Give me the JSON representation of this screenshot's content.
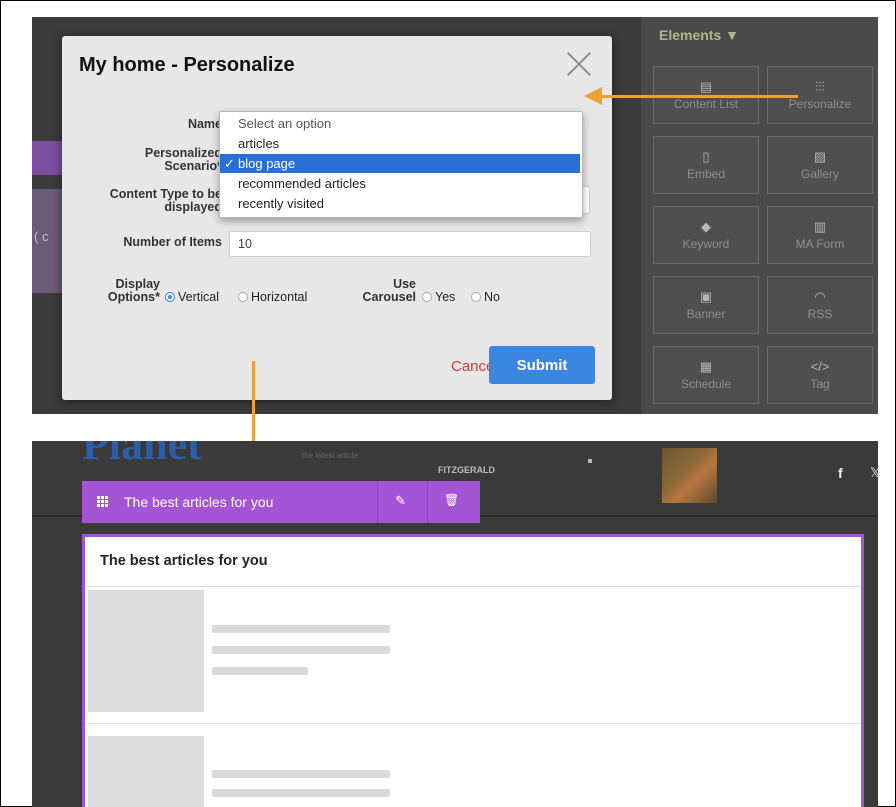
{
  "top_screenshot": {
    "partial_left_text": "( c",
    "elements_panel": {
      "title": "Elements ▼",
      "tiles": [
        {
          "label": "Content List",
          "icon": "content-list-icon",
          "glyph": "▤"
        },
        {
          "label": "Personalize",
          "icon": "personalize-sliders-icon",
          "glyph": "⫶⫶⫶"
        },
        {
          "label": "Embed",
          "icon": "embed-document-icon",
          "glyph": "▯"
        },
        {
          "label": "Gallery",
          "icon": "gallery-image-icon",
          "glyph": "▨"
        },
        {
          "label": "Keyword",
          "icon": "keyword-tag-icon",
          "glyph": "◆"
        },
        {
          "label": "MA Form",
          "icon": "ma-form-chart-icon",
          "glyph": "▥"
        },
        {
          "label": "Banner",
          "icon": "banner-icon",
          "glyph": "▣"
        },
        {
          "label": "RSS",
          "icon": "rss-icon",
          "glyph": "◠"
        },
        {
          "label": "Schedule",
          "icon": "schedule-calendar-icon",
          "glyph": "▦"
        },
        {
          "label": "Tag",
          "icon": "tag-code-icon",
          "glyph": "</>"
        }
      ]
    },
    "modal": {
      "title": "My home - Personalize",
      "fields": {
        "name_label": "Name",
        "scenario_label_1": "Personalized",
        "scenario_label_2": "Scenario*",
        "content_type_label_1": "Content Type to be",
        "content_type_label_2": "displayed",
        "number_label": "Number of Items",
        "number_value": "10",
        "display_label_1": "Display",
        "display_label_2": "Options*",
        "display_options": [
          "Vertical",
          "Horizontal"
        ],
        "display_selected": "Vertical",
        "carousel_label_1": "Use",
        "carousel_label_2": "Carousel",
        "carousel_options": [
          "Yes",
          "No"
        ],
        "carousel_selected": "No"
      },
      "dropdown": {
        "placeholder": "Select an option",
        "options": [
          "articles",
          "blog page",
          "recommended articles",
          "recently visited"
        ],
        "selected": "blog page",
        "check_glyph": "✓"
      },
      "cancel_label": "Cancel",
      "submit_label": "Submit"
    }
  },
  "bottom_screenshot": {
    "site_logo_partial": "Planet",
    "header_small_text": "the latest article",
    "header_author": "FITZGERALD",
    "social": [
      "f",
      "𝕏"
    ],
    "toolbar_title": "The best articles for you",
    "toolbar_edit_glyph": "✎",
    "toolbar_delete_glyph": "🗑",
    "content_heading": "The best articles for you"
  },
  "colors": {
    "accent_purple": "#a455d6",
    "submit_blue": "#3a86e0",
    "cancel_red": "#d13c3c",
    "arrow_orange": "#f0a030",
    "selection_blue": "#2a6fd6"
  }
}
